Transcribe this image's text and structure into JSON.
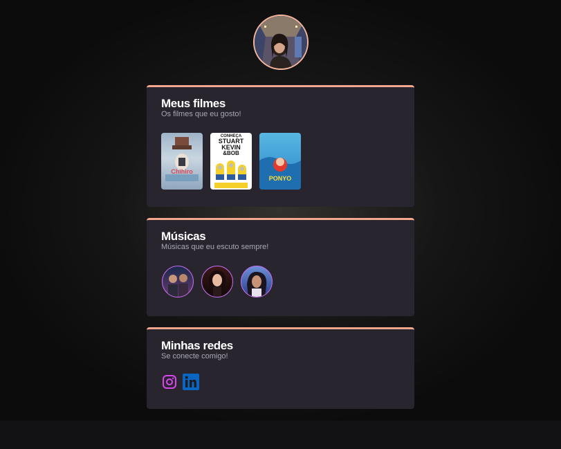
{
  "profile": {
    "avatar_alt": "profile-photo"
  },
  "movies": {
    "title": "Meus filmes",
    "subtitle": "Os filmes que eu gosto!",
    "items": [
      {
        "name": "Chihiro",
        "poster_text": "Chihiro"
      },
      {
        "name": "Minions",
        "poster_text_lines": [
          "CONHEÇA",
          "STUART",
          "KEVIN",
          "&BOB"
        ]
      },
      {
        "name": "Ponyo",
        "poster_text": "PONYO"
      }
    ]
  },
  "music": {
    "title": "Músicas",
    "subtitle": "Músicas que eu escuto sempre!",
    "artists": [
      "artist-1",
      "artist-2",
      "artist-3"
    ]
  },
  "social": {
    "title": "Minhas redes",
    "subtitle": "Se conecte comigo!",
    "links": [
      {
        "name": "Instagram",
        "icon": "instagram-icon",
        "color": "#d946ef"
      },
      {
        "name": "LinkedIn",
        "icon": "linkedin-icon",
        "color": "#0a66c2",
        "glyph": "in"
      }
    ]
  },
  "colors": {
    "accent": "#f4a78f",
    "card_bg": "#29252f",
    "artist_border": "#c56cf0"
  }
}
